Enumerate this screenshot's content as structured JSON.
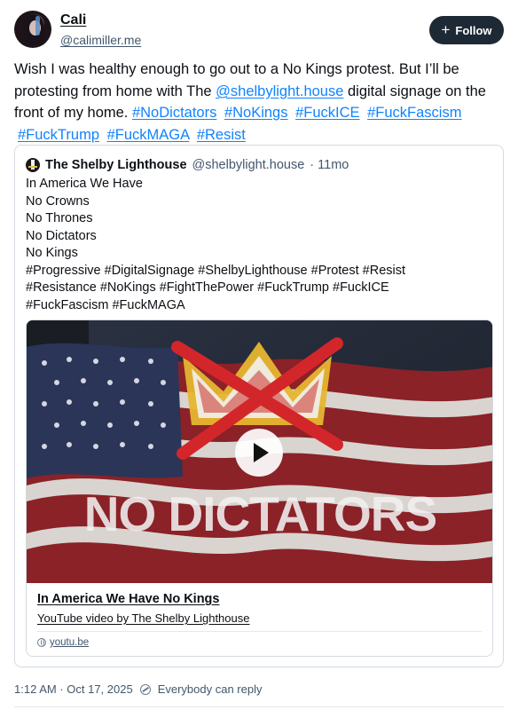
{
  "post": {
    "author": {
      "display_name": "Cali",
      "handle": "@calimiller.me"
    },
    "follow_label": "Follow",
    "text": {
      "prefix": "Wish I was healthy enough to go out to a No Kings protest. But I’ll be protesting from home with The ",
      "mention": "@shelbylight.house",
      "suffix": " digital signage on the front of my home. ",
      "hashtags": [
        "#NoDictators",
        "#NoKings",
        "#FuckICE",
        "#FuckFascism",
        "#FuckTrump",
        "#FuckMAGA",
        "#Resist"
      ]
    },
    "timestamp": "1:12 AM · Oct 17, 2025",
    "reply_setting": "Everybody can reply"
  },
  "quote": {
    "author_name": "The Shelby Lighthouse",
    "author_handle": "@shelbylight.house",
    "age": "· 11mo",
    "lines": [
      "In America We Have",
      "No Crowns",
      "No Thrones",
      "No Dictators",
      "No Kings",
      "#Progressive #DigitalSignage #ShelbyLighthouse #Protest #Resist",
      "#Resistance #NoKings #FightThePower #FuckTrump #FuckICE",
      "#FuckFascism #FuckMAGA"
    ],
    "embed": {
      "thumbnail_text": "NO DICTATORS",
      "title": "In America We Have No Kings",
      "description": "YouTube video by The Shelby Lighthouse",
      "domain": "youtu.be"
    }
  },
  "icons": {
    "follow": "plus-icon",
    "play": "play-icon",
    "domain": "globe-icon",
    "reply": "reply-settings-icon"
  },
  "colors": {
    "link": "#1083fe",
    "follow_button": "#1e2936",
    "muted_text": "#42576c",
    "border": "#d4dbe2"
  }
}
